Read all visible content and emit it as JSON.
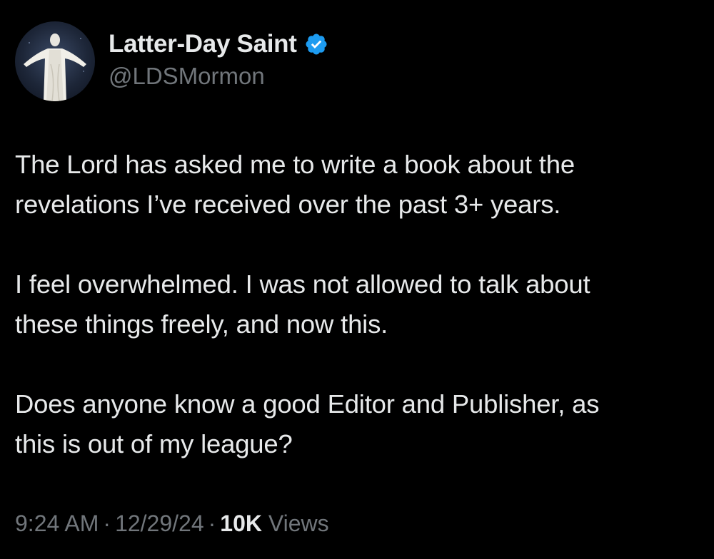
{
  "author": {
    "display_name": "Latter-Day Saint",
    "handle": "@LDSMormon",
    "verified": true,
    "verified_color": "#1d9bf0",
    "avatar_icon": "statue-avatar"
  },
  "tweet": {
    "paragraphs": [
      "The Lord has asked me to write a book about the\nrevelations I’ve received over the past 3+ years.",
      "I feel overwhelmed. I was not allowed to talk about\nthese things freely, and now this.",
      "Does anyone know a good Editor and Publisher, as\nthis is out of my league?"
    ]
  },
  "meta": {
    "time": "9:24 AM",
    "separator": "·",
    "date": "12/29/24",
    "views_count": "10K",
    "views_label": "Views"
  },
  "colors": {
    "background": "#000000",
    "primary_text": "#e7e9ea",
    "secondary_text": "#71767b",
    "accent": "#1d9bf0"
  }
}
